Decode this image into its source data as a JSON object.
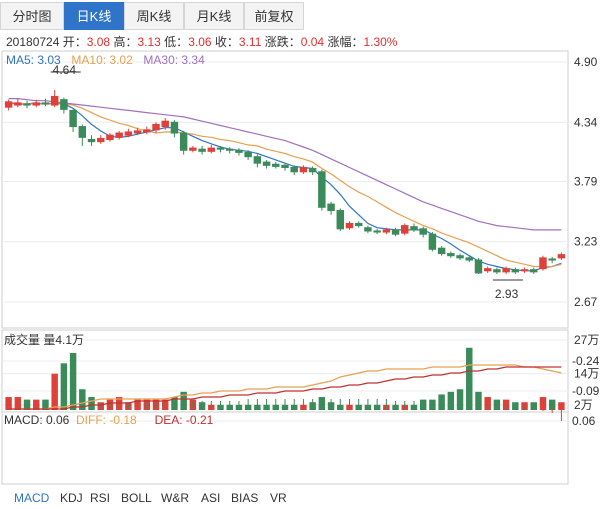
{
  "tabs": [
    {
      "label": "分时图"
    },
    {
      "label": "日K线"
    },
    {
      "label": "周K线"
    },
    {
      "label": "月K线"
    },
    {
      "label": "前复权"
    }
  ],
  "active_tab": 1,
  "info": {
    "date": "20180724",
    "open_label": "开：",
    "open": "3.08",
    "high_label": "高：",
    "high": "3.13",
    "low_label": "低：",
    "low": "3.06",
    "close_label": "收：",
    "close": "3.11",
    "change_label": "涨跌：",
    "change": "0.04",
    "pct_label": "涨幅：",
    "pct": "1.30%"
  },
  "ma_legend": [
    {
      "label": "MA5: 3.03",
      "color": "#2f74c8"
    },
    {
      "label": "MA10: 3.02",
      "color": "#e8a050"
    },
    {
      "label": "MA30: 3.34",
      "color": "#a070c0"
    }
  ],
  "volume_legend": "成交量 量4.1万",
  "macd_legend": [
    {
      "label": "MACD: 0.06",
      "color": "#333333"
    },
    {
      "label": "DIFF: -0.18",
      "color": "#e8a050"
    },
    {
      "label": "DEA: -0.21",
      "color": "#c03030"
    }
  ],
  "bottom_tabs": [
    "MACD",
    "KDJ",
    "RSI",
    "BOLL",
    "W&R",
    "ASI",
    "BIAS",
    "VR"
  ],
  "bottom_active": 0,
  "chart_data": {
    "type": "candlestick",
    "price_axis": {
      "ticks": [
        4.9,
        4.34,
        3.79,
        3.23,
        2.67
      ],
      "tick_labels": [
        "4.90",
        "4.34",
        "3.79",
        "3.23",
        "2.67"
      ],
      "range": [
        2.67,
        4.9
      ]
    },
    "volume_axis": {
      "ticks": [
        27,
        14,
        2
      ],
      "tick_labels": [
        "27万",
        "14万",
        "2万"
      ],
      "range": [
        0,
        27
      ]
    },
    "macd_axis": {
      "ticks": [
        0.06,
        -0.09,
        -0.24
      ],
      "tick_labels": [
        "0.06",
        "-0.09",
        "-0.24"
      ],
      "range": [
        -0.24,
        0.06
      ]
    },
    "annotations": [
      {
        "label": "4.64",
        "index": 5,
        "value": 4.64
      },
      {
        "label": "2.93",
        "index": 53,
        "value": 2.93
      }
    ],
    "candles": [
      [
        4.48,
        4.53,
        4.45,
        4.55
      ],
      [
        4.5,
        4.52,
        4.48,
        4.56
      ],
      [
        4.51,
        4.5,
        4.47,
        4.54
      ],
      [
        4.5,
        4.52,
        4.48,
        4.55
      ],
      [
        4.52,
        4.51,
        4.49,
        4.56
      ],
      [
        4.5,
        4.58,
        4.48,
        4.64
      ],
      [
        4.55,
        4.46,
        4.42,
        4.57
      ],
      [
        4.45,
        4.3,
        4.25,
        4.46
      ],
      [
        4.3,
        4.2,
        4.12,
        4.32
      ],
      [
        4.18,
        4.16,
        4.12,
        4.22
      ],
      [
        4.16,
        4.19,
        4.14,
        4.22
      ],
      [
        4.18,
        4.22,
        4.16,
        4.24
      ],
      [
        4.2,
        4.24,
        4.18,
        4.26
      ],
      [
        4.22,
        4.25,
        4.2,
        4.28
      ],
      [
        4.24,
        4.26,
        4.22,
        4.29
      ],
      [
        4.25,
        4.27,
        4.23,
        4.3
      ],
      [
        4.27,
        4.32,
        4.24,
        4.34
      ],
      [
        4.3,
        4.35,
        4.27,
        4.38
      ],
      [
        4.34,
        4.24,
        4.2,
        4.36
      ],
      [
        4.24,
        4.08,
        4.04,
        4.26
      ],
      [
        4.08,
        4.1,
        4.06,
        4.12
      ],
      [
        4.09,
        4.07,
        4.04,
        4.12
      ],
      [
        4.07,
        4.1,
        4.05,
        4.13
      ],
      [
        4.1,
        4.09,
        4.06,
        4.12
      ],
      [
        4.09,
        4.08,
        4.05,
        4.11
      ],
      [
        4.08,
        4.06,
        4.03,
        4.1
      ],
      [
        4.06,
        4.02,
        3.99,
        4.08
      ],
      [
        4.02,
        3.96,
        3.92,
        4.04
      ],
      [
        3.97,
        3.94,
        3.91,
        3.99
      ],
      [
        3.95,
        3.93,
        3.91,
        3.97
      ],
      [
        3.94,
        3.92,
        3.89,
        3.96
      ],
      [
        3.92,
        3.88,
        3.85,
        3.94
      ],
      [
        3.88,
        3.92,
        3.86,
        3.94
      ],
      [
        3.91,
        3.88,
        3.85,
        3.93
      ],
      [
        3.88,
        3.55,
        3.52,
        3.9
      ],
      [
        3.58,
        3.52,
        3.48,
        3.6
      ],
      [
        3.52,
        3.35,
        3.33,
        3.54
      ],
      [
        3.36,
        3.4,
        3.34,
        3.42
      ],
      [
        3.4,
        3.38,
        3.36,
        3.42
      ],
      [
        3.36,
        3.33,
        3.31,
        3.38
      ],
      [
        3.33,
        3.32,
        3.3,
        3.35
      ],
      [
        3.32,
        3.34,
        3.3,
        3.36
      ],
      [
        3.34,
        3.3,
        3.28,
        3.36
      ],
      [
        3.31,
        3.38,
        3.29,
        3.4
      ],
      [
        3.37,
        3.34,
        3.32,
        3.4
      ],
      [
        3.35,
        3.3,
        3.27,
        3.37
      ],
      [
        3.3,
        3.16,
        3.14,
        3.32
      ],
      [
        3.17,
        3.12,
        3.1,
        3.19
      ],
      [
        3.12,
        3.1,
        3.08,
        3.14
      ],
      [
        3.1,
        3.08,
        3.06,
        3.12
      ],
      [
        3.08,
        3.06,
        3.04,
        3.1
      ],
      [
        3.06,
        2.94,
        2.93,
        3.08
      ],
      [
        2.96,
        2.98,
        2.94,
        3.0
      ],
      [
        2.97,
        2.95,
        2.93,
        2.99
      ],
      [
        2.95,
        2.98,
        2.93,
        3.0
      ],
      [
        2.97,
        2.95,
        2.93,
        2.99
      ],
      [
        2.96,
        2.97,
        2.94,
        2.99
      ],
      [
        2.97,
        2.95,
        2.93,
        2.99
      ],
      [
        2.98,
        3.08,
        2.96,
        3.1
      ],
      [
        3.07,
        3.06,
        3.03,
        3.09
      ],
      [
        3.08,
        3.11,
        3.06,
        3.13
      ]
    ],
    "ma5": [
      4.52,
      4.51,
      4.51,
      4.52,
      4.51,
      4.52,
      4.51,
      4.47,
      4.4,
      4.32,
      4.26,
      4.21,
      4.2,
      4.21,
      4.23,
      4.25,
      4.27,
      4.29,
      4.29,
      4.25,
      4.21,
      4.17,
      4.14,
      4.11,
      4.09,
      4.08,
      4.07,
      4.05,
      4.02,
      3.99,
      3.96,
      3.93,
      3.92,
      3.91,
      3.83,
      3.76,
      3.67,
      3.56,
      3.48,
      3.4,
      3.36,
      3.35,
      3.34,
      3.34,
      3.34,
      3.34,
      3.3,
      3.26,
      3.21,
      3.15,
      3.1,
      3.05,
      3.02,
      3.0,
      2.98,
      2.97,
      2.96,
      2.96,
      2.99,
      3.0,
      3.03
    ],
    "ma10": [
      4.52,
      4.52,
      4.51,
      4.51,
      4.51,
      4.51,
      4.51,
      4.5,
      4.47,
      4.43,
      4.39,
      4.36,
      4.33,
      4.31,
      4.28,
      4.26,
      4.24,
      4.25,
      4.25,
      4.24,
      4.23,
      4.21,
      4.2,
      4.18,
      4.17,
      4.15,
      4.13,
      4.12,
      4.09,
      4.07,
      4.05,
      4.02,
      4.0,
      3.97,
      3.91,
      3.86,
      3.8,
      3.74,
      3.69,
      3.65,
      3.6,
      3.55,
      3.5,
      3.46,
      3.42,
      3.38,
      3.35,
      3.31,
      3.28,
      3.25,
      3.22,
      3.18,
      3.14,
      3.1,
      3.06,
      3.04,
      3.02,
      3.0,
      3.0,
      3.0,
      3.02
    ],
    "ma30": [
      4.56,
      4.56,
      4.55,
      4.54,
      4.54,
      4.53,
      4.52,
      4.51,
      4.5,
      4.49,
      4.48,
      4.47,
      4.46,
      4.45,
      4.44,
      4.43,
      4.42,
      4.41,
      4.4,
      4.39,
      4.37,
      4.35,
      4.33,
      4.31,
      4.29,
      4.27,
      4.25,
      4.23,
      4.21,
      4.19,
      4.17,
      4.14,
      4.11,
      4.08,
      4.04,
      4.0,
      3.96,
      3.92,
      3.88,
      3.84,
      3.8,
      3.76,
      3.72,
      3.68,
      3.64,
      3.6,
      3.57,
      3.54,
      3.51,
      3.48,
      3.45,
      3.42,
      3.4,
      3.38,
      3.37,
      3.36,
      3.35,
      3.34,
      3.34,
      3.34,
      3.34
    ],
    "volume": [
      5,
      5,
      4,
      4,
      4,
      14,
      18,
      22,
      8,
      5,
      3,
      4,
      5,
      3,
      4,
      4,
      4,
      4,
      5,
      7,
      4,
      3,
      2,
      2,
      2,
      2,
      2,
      2,
      2,
      2,
      2,
      2,
      2,
      3,
      5,
      3,
      2,
      2,
      2,
      2,
      2,
      2,
      2,
      2,
      2,
      4,
      4,
      6,
      7,
      8,
      24,
      7,
      5,
      4,
      4,
      3,
      3,
      3,
      5,
      4,
      3
    ],
    "macd": [
      0,
      0,
      0,
      0,
      0,
      0,
      0,
      -0.01,
      -0.02,
      -0.03,
      -0.03,
      -0.03,
      -0.03,
      -0.03,
      -0.03,
      -0.03,
      -0.03,
      -0.03,
      -0.04,
      -0.04,
      -0.04,
      -0.04,
      -0.04,
      -0.04,
      -0.04,
      -0.04,
      -0.05,
      -0.05,
      -0.05,
      -0.05,
      -0.05,
      -0.05,
      -0.05,
      -0.05,
      -0.05,
      -0.05,
      -0.05,
      -0.05,
      -0.05,
      -0.05,
      -0.05,
      -0.05,
      -0.04,
      -0.04,
      -0.04,
      -0.04,
      -0.04,
      -0.04,
      -0.04,
      -0.04,
      -0.03,
      -0.03,
      -0.02,
      -0.02,
      -0.02,
      -0.01,
      -0.01,
      0,
      0.01,
      0.02,
      0.06
    ],
    "diff": [
      0,
      0,
      0,
      0,
      0,
      -0.01,
      -0.01,
      -0.02,
      -0.03,
      -0.04,
      -0.05,
      -0.05,
      -0.05,
      -0.05,
      -0.05,
      -0.05,
      -0.05,
      -0.05,
      -0.06,
      -0.07,
      -0.07,
      -0.08,
      -0.08,
      -0.09,
      -0.09,
      -0.09,
      -0.1,
      -0.1,
      -0.1,
      -0.11,
      -0.11,
      -0.11,
      -0.11,
      -0.12,
      -0.13,
      -0.14,
      -0.16,
      -0.17,
      -0.18,
      -0.19,
      -0.19,
      -0.2,
      -0.2,
      -0.2,
      -0.2,
      -0.2,
      -0.21,
      -0.21,
      -0.21,
      -0.21,
      -0.22,
      -0.22,
      -0.22,
      -0.22,
      -0.22,
      -0.22,
      -0.21,
      -0.21,
      -0.2,
      -0.19,
      -0.18
    ],
    "dea": [
      0,
      0,
      0,
      0,
      0,
      0,
      0,
      -0.01,
      -0.01,
      -0.02,
      -0.02,
      -0.03,
      -0.03,
      -0.03,
      -0.04,
      -0.04,
      -0.04,
      -0.04,
      -0.05,
      -0.05,
      -0.05,
      -0.06,
      -0.06,
      -0.06,
      -0.07,
      -0.07,
      -0.07,
      -0.08,
      -0.08,
      -0.08,
      -0.09,
      -0.09,
      -0.09,
      -0.1,
      -0.1,
      -0.11,
      -0.11,
      -0.12,
      -0.12,
      -0.13,
      -0.13,
      -0.14,
      -0.15,
      -0.15,
      -0.16,
      -0.16,
      -0.17,
      -0.17,
      -0.18,
      -0.18,
      -0.19,
      -0.19,
      -0.2,
      -0.2,
      -0.21,
      -0.21,
      -0.21,
      -0.21,
      -0.21,
      -0.21,
      -0.21
    ]
  }
}
